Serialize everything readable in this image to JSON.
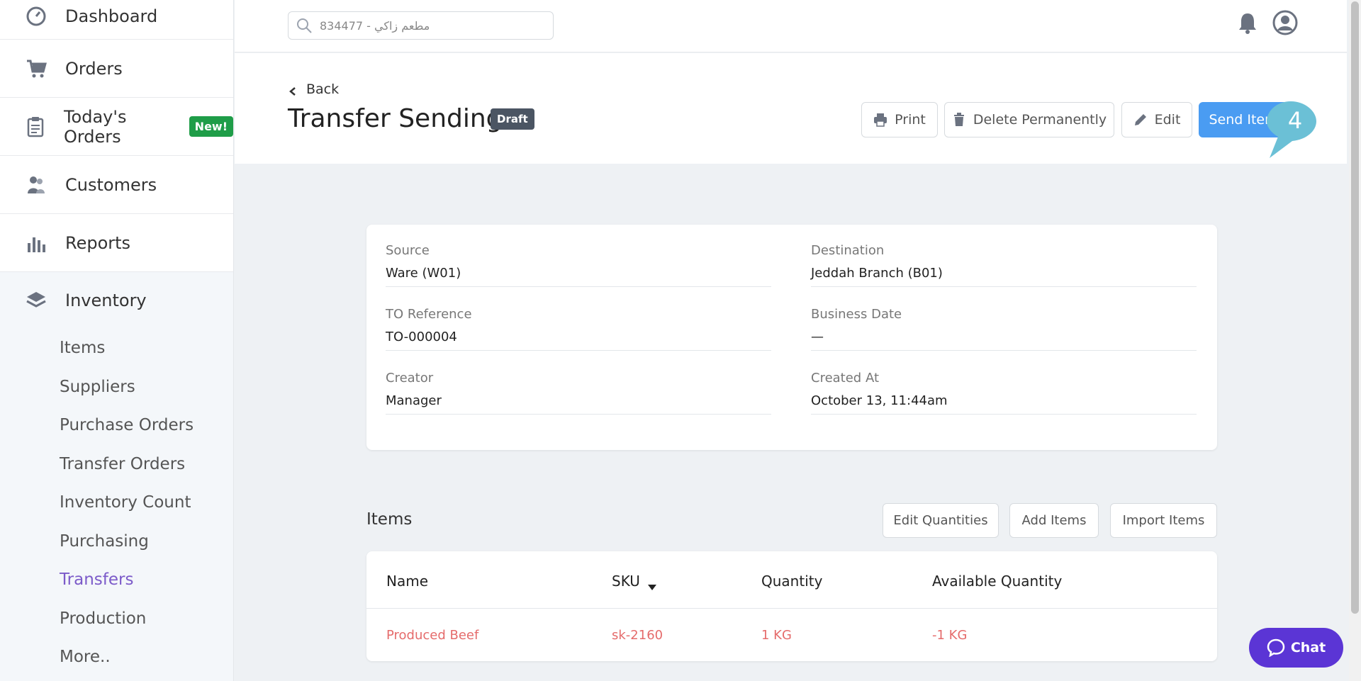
{
  "sidebar": {
    "nav": [
      {
        "label": "Dashboard",
        "icon": "dashboard-icon"
      },
      {
        "label": "Orders",
        "icon": "cart-icon"
      },
      {
        "label": "Today's Orders",
        "icon": "clipboard-icon",
        "badge": "New!"
      },
      {
        "label": "Customers",
        "icon": "customers-icon"
      },
      {
        "label": "Reports",
        "icon": "bar-chart-icon"
      }
    ],
    "inventory": {
      "label": "Inventory",
      "icon": "layers-icon",
      "items": [
        "Items",
        "Suppliers",
        "Purchase Orders",
        "Transfer Orders",
        "Inventory Count",
        "Purchasing",
        "Transfers",
        "Production",
        "More.."
      ],
      "active": "Transfers"
    }
  },
  "topbar": {
    "search_value": "مطعم زاكي - 834477"
  },
  "header": {
    "back_label": "Back",
    "title": "Transfer Sending",
    "status": "Draft",
    "buttons": {
      "print": "Print",
      "delete": "Delete Permanently",
      "edit": "Edit",
      "send": "Send Items"
    },
    "callout_number": "4"
  },
  "details": {
    "source_label": "Source",
    "source_value": "Ware (W01)",
    "destination_label": "Destination",
    "destination_value": "Jeddah Branch (B01)",
    "reference_label": "TO Reference",
    "reference_value": "TO-000004",
    "business_date_label": "Business Date",
    "business_date_value": "—",
    "creator_label": "Creator",
    "creator_value": "Manager",
    "created_at_label": "Created At",
    "created_at_value": "October 13, 11:44am"
  },
  "items": {
    "title": "Items",
    "buttons": {
      "edit_quantities": "Edit Quantities",
      "add_items": "Add Items",
      "import_items": "Import Items"
    },
    "columns": {
      "name": "Name",
      "sku": "SKU",
      "quantity": "Quantity",
      "available": "Available Quantity"
    },
    "rows": [
      {
        "name": "Produced Beef",
        "sku": "sk-2160",
        "quantity": "1 KG",
        "available": "-1 KG"
      }
    ]
  },
  "chat": {
    "label": "Chat"
  },
  "colors": {
    "accent": "#4a9cf2",
    "active_nav": "#7c5bc9",
    "negative": "#e56b6b",
    "chat": "#5b35d5",
    "callout": "#6bc0d6"
  }
}
